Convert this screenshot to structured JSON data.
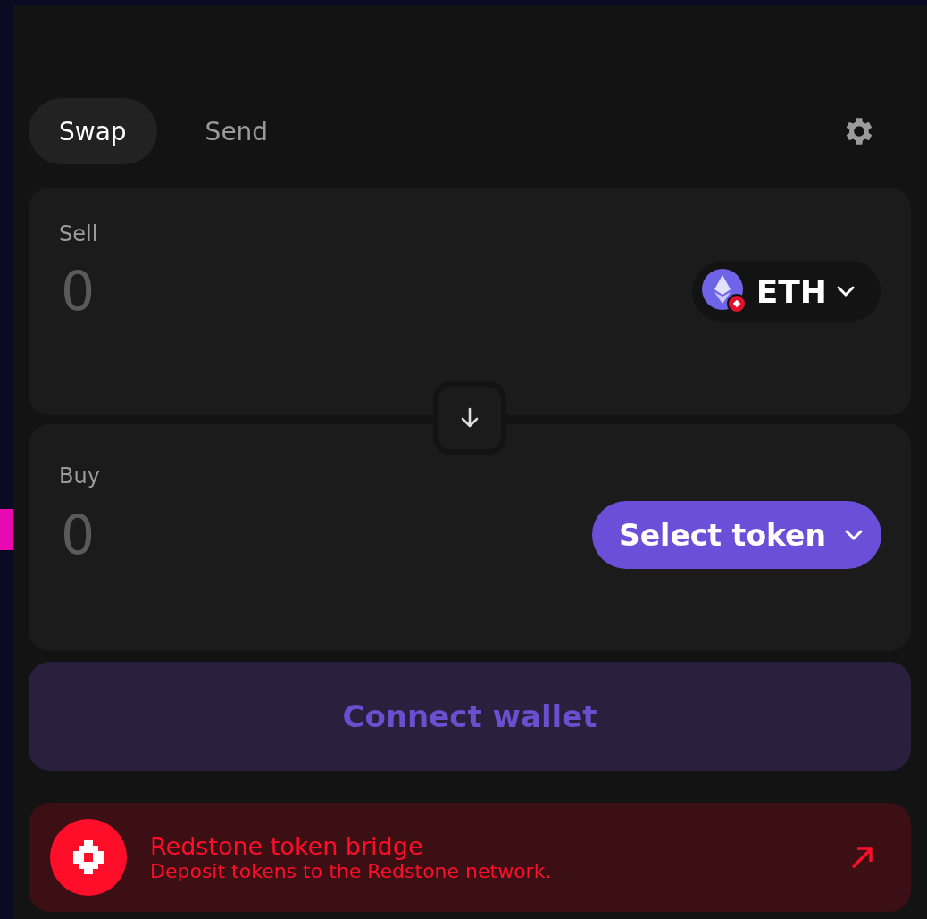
{
  "tabs": [
    {
      "label": "Swap",
      "selected": true
    },
    {
      "label": "Send",
      "selected": false
    }
  ],
  "sell": {
    "label": "Sell",
    "placeholder": "0",
    "token": {
      "symbol": "ETH"
    }
  },
  "buy": {
    "label": "Buy",
    "placeholder": "0",
    "select_label": "Select token"
  },
  "connect_button": {
    "label": "Connect wallet",
    "disabled": true
  },
  "banner": {
    "title": "Redstone token bridge",
    "subtitle": "Deposit tokens to the Redstone network."
  }
}
